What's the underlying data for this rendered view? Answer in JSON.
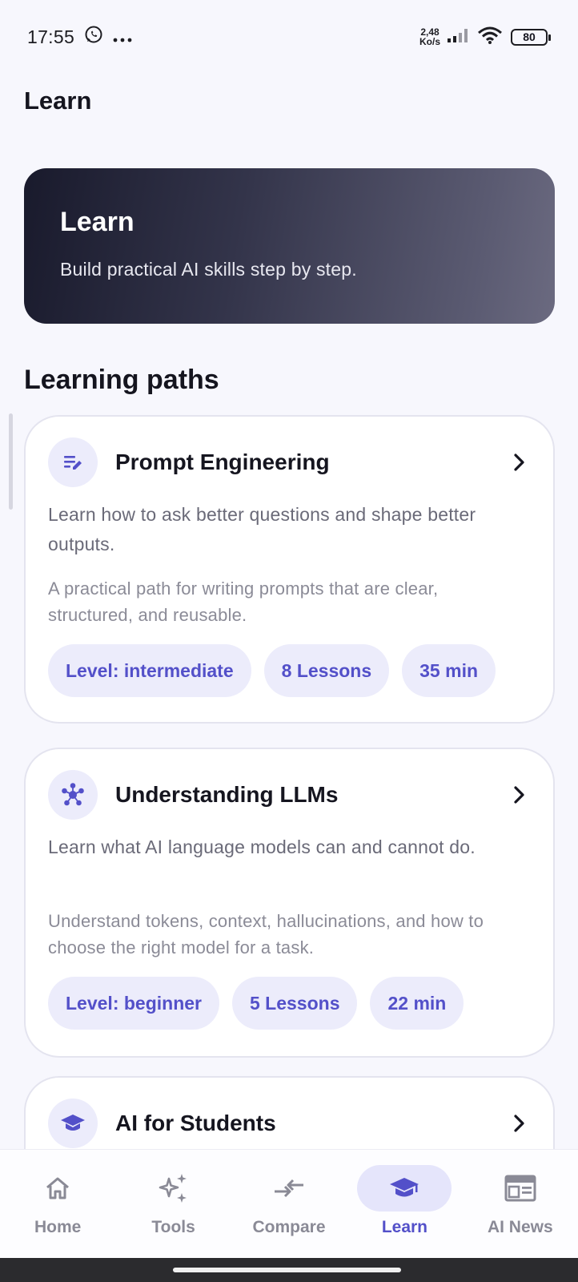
{
  "status_bar": {
    "time": "17:55",
    "net_speed_value": "2,48",
    "net_speed_unit": "Ko/s",
    "battery": "80",
    "icons": [
      "whatsapp-icon",
      "more-dots-icon",
      "signal-icon",
      "wifi-icon",
      "battery-icon"
    ]
  },
  "page": {
    "title": "Learn"
  },
  "hero": {
    "title": "Learn",
    "subtitle": "Build practical AI skills step by step."
  },
  "section": {
    "title": "Learning paths"
  },
  "paths": [
    {
      "icon": "edit-note-icon",
      "title": "Prompt Engineering",
      "summary": "Learn how to ask better questions and shape better outputs.",
      "description": "A practical path for writing prompts that are clear, structured, and reusable.",
      "level": "Level: intermediate",
      "lessons": "8 Lessons",
      "duration": "35 min"
    },
    {
      "icon": "network-hub-icon",
      "title": "Understanding LLMs",
      "summary": "Learn what AI language models can and cannot do.",
      "description": "Understand tokens, context, hallucinations, and how to choose the right model for a task.",
      "level": "Level: beginner",
      "lessons": "5 Lessons",
      "duration": "22 min"
    },
    {
      "icon": "graduation-cap-icon",
      "title": "AI for Students"
    }
  ],
  "nav": {
    "items": [
      {
        "label": "Home",
        "icon": "home-icon"
      },
      {
        "label": "Tools",
        "icon": "sparkles-icon"
      },
      {
        "label": "Compare",
        "icon": "compare-arrows-icon"
      },
      {
        "label": "Learn",
        "icon": "graduation-cap-icon",
        "active": true
      },
      {
        "label": "AI News",
        "icon": "newspaper-icon"
      }
    ]
  },
  "colors": {
    "accent": "#5350c9",
    "accent_bg": "#ececfb",
    "page_bg": "#f7f7fd"
  }
}
